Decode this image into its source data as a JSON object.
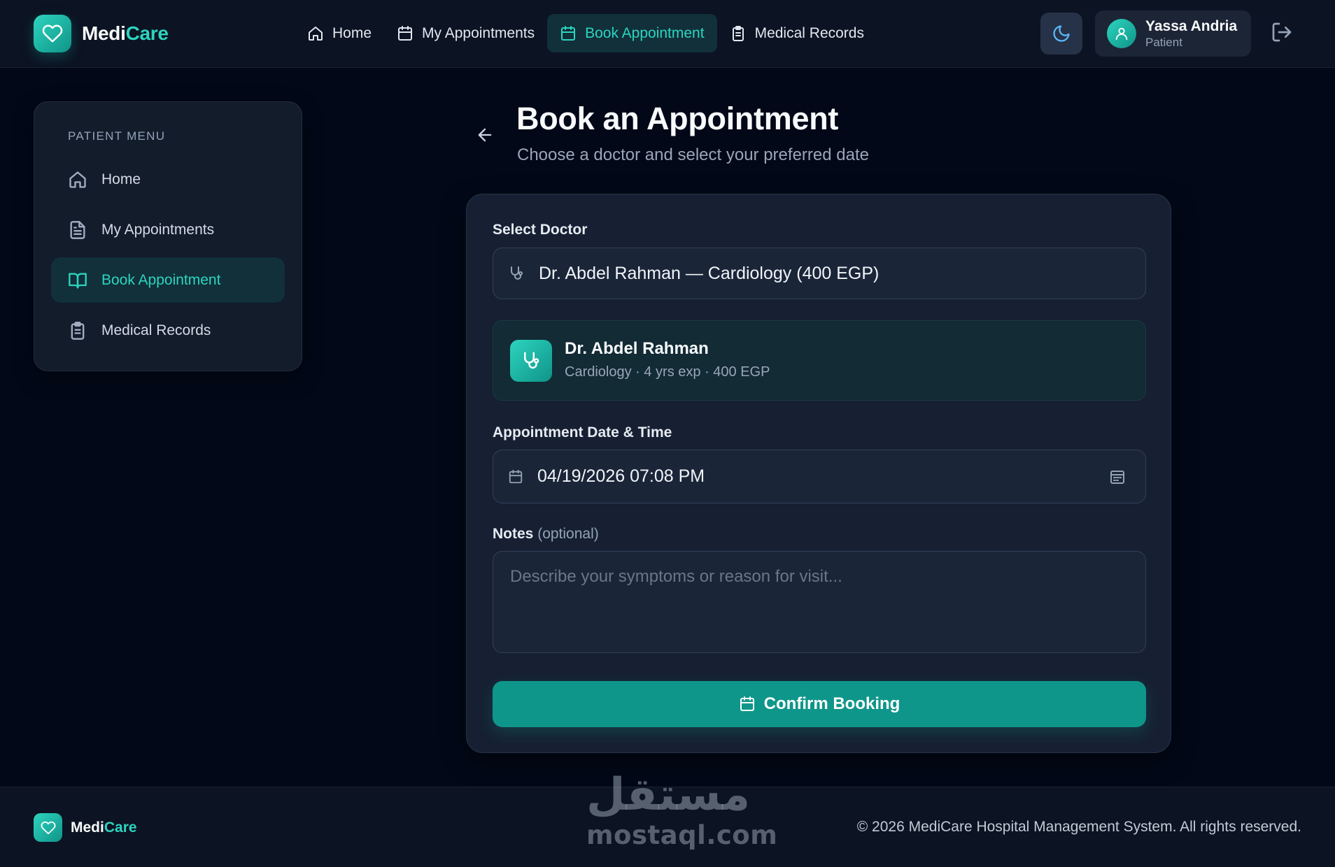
{
  "brand": {
    "name_part1": "Medi",
    "name_part2": "Care"
  },
  "nav": {
    "items": [
      {
        "label": "Home",
        "icon": "home-icon"
      },
      {
        "label": "My Appointments",
        "icon": "calendar-icon"
      },
      {
        "label": "Book Appointment",
        "icon": "calendar-icon",
        "active": true
      },
      {
        "label": "Medical Records",
        "icon": "clipboard-icon"
      }
    ]
  },
  "header": {
    "theme_icon": "moon-icon",
    "user": {
      "name": "Yassa Andria",
      "role": "Patient"
    },
    "logout_icon": "logout-icon"
  },
  "sidebar": {
    "title": "PATIENT MENU",
    "items": [
      {
        "label": "Home",
        "icon": "home-icon"
      },
      {
        "label": "My Appointments",
        "icon": "file-text-icon"
      },
      {
        "label": "Book Appointment",
        "icon": "book-open-icon",
        "active": true
      },
      {
        "label": "Medical Records",
        "icon": "clipboard-icon"
      }
    ]
  },
  "page": {
    "title": "Book an Appointment",
    "subtitle": "Choose a doctor and select your preferred date"
  },
  "form": {
    "doctor_label": "Select Doctor",
    "doctor_value": "Dr. Abdel Rahman — Cardiology (400 EGP)",
    "selected_doctor": {
      "name": "Dr. Abdel Rahman",
      "details": "Cardiology · 4 yrs exp · 400 EGP"
    },
    "datetime_label": "Appointment Date & Time",
    "datetime_value": "04/19/2026 07:08 PM",
    "notes_label": "Notes",
    "notes_optional": "(optional)",
    "notes_placeholder": "Describe your symptoms or reason for visit...",
    "confirm_label": "Confirm Booking"
  },
  "footer": {
    "copyright": "© 2026 MediCare Hospital Management System. All rights reserved."
  },
  "watermark": {
    "arabic": "مستقل",
    "latin": "mostaql.com"
  },
  "colors": {
    "accent": "#2dd4bf",
    "button": "#0f968a",
    "background": "#020817",
    "card": "#162032"
  }
}
